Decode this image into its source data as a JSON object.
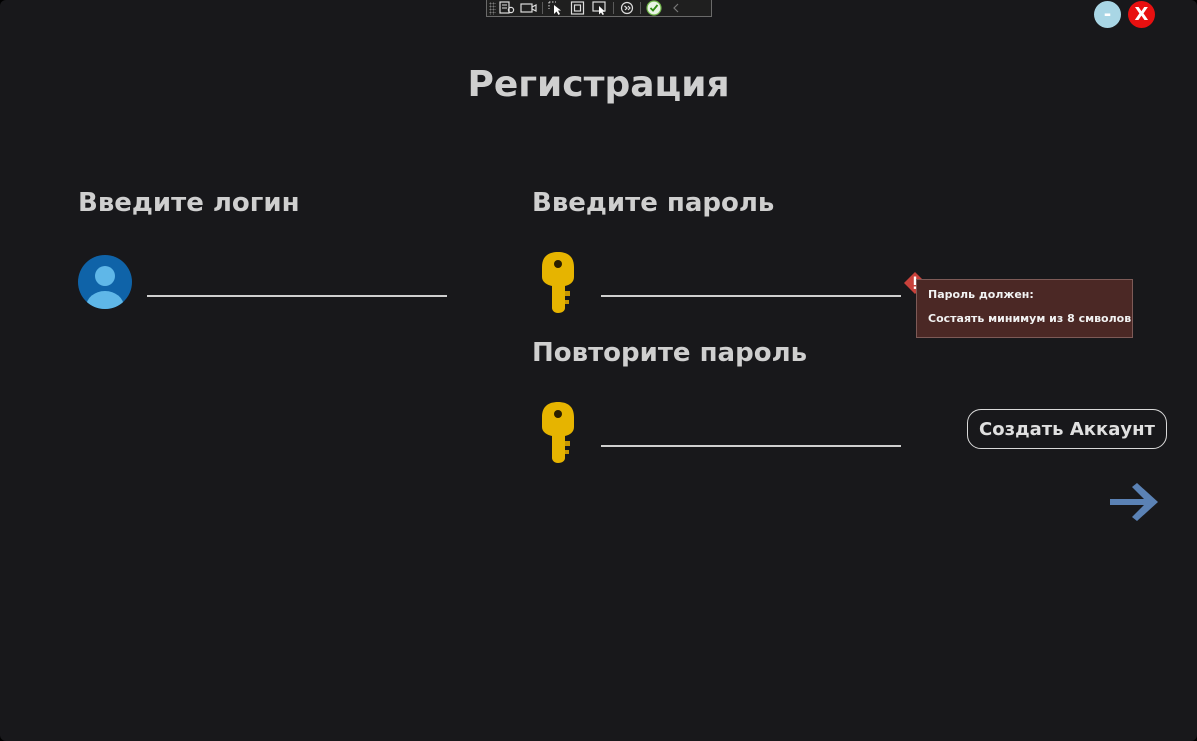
{
  "window": {
    "minimize_label": "-",
    "close_label": "X"
  },
  "header": {
    "title": "Регистрация"
  },
  "login": {
    "label": "Введите логин",
    "value": "",
    "icon": "user-avatar-icon"
  },
  "password": {
    "label": "Введите пароль",
    "value": "",
    "icon": "key-icon"
  },
  "repeat_password": {
    "label": "Повторите пароль",
    "value": "",
    "icon": "key-icon"
  },
  "validation": {
    "line1": "Пароль должен:",
    "line2": "Состаять минимум из 8 смволов",
    "color": "#4b2825",
    "badge_color": "#c8413b"
  },
  "actions": {
    "create_label": "Создать Аккаунт",
    "next_icon": "arrow-right-icon"
  },
  "colors": {
    "background": "#18181b",
    "text": "#cfcfcf",
    "accent_arrow": "#5b82b5",
    "close": "#e81010",
    "minimize": "#a9d6e5"
  }
}
